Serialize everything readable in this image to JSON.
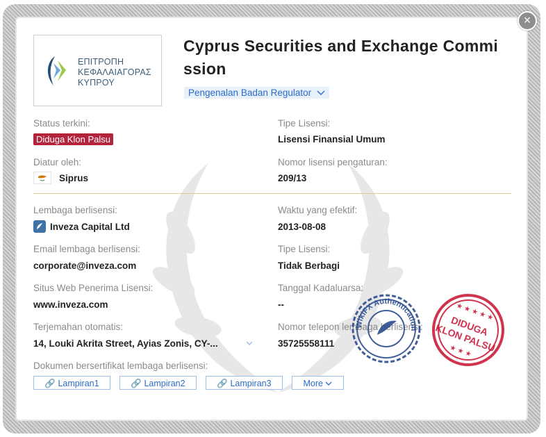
{
  "header": {
    "close_symbol": "×",
    "logo_lines": [
      "ΕΠΙΤΡΟΠΗ",
      "ΚΕΦΑΛΑΙΑΓΟΡΑΣ",
      "ΚΥΠΡΟΥ"
    ],
    "title": "Cyprus Securities and Exchange Commission",
    "title_line1": "Cyprus Securities and Exchange Commi",
    "title_line2": "ssion",
    "regulator_intro": "Pengenalan Badan Regulator"
  },
  "fields": {
    "status_label": "Status terkini:",
    "status_value": "Diduga Klon Palsu",
    "license_type_label": "Tipe Lisensi:",
    "license_type_value": "Lisensi Finansial Umum",
    "regulated_by_label": "Diatur oleh:",
    "regulated_by_value": "Siprus",
    "regulatory_license_no_label": "Nomor lisensi pengaturan:",
    "regulatory_license_no_value": "209/13",
    "licensed_institution_label": "Lembaga berlisensi:",
    "licensed_institution_value": "Inveza Capital Ltd",
    "effective_time_label": "Waktu yang efektif:",
    "effective_time_value": "2013-08-08",
    "institution_email_label": "Email lembaga berlisensi:",
    "institution_email_value": "corporate@inveza.com",
    "license_type2_label": "Tipe Lisensi:",
    "license_type2_value": "Tidak Berbagi",
    "website_label": "Situs Web Penerima Lisensi:",
    "website_value": "www.inveza.com",
    "expiry_label": "Tanggal Kadaluarsa:",
    "expiry_value": "--",
    "auto_translation_label": "Terjemahan otomatis:",
    "address_value": "14, Louki Akrita Street, Ayias Zonis, CY-...",
    "phone_label": "Nomor telepon lembaga berlisensi:",
    "phone_value": "35725558111",
    "documents_label": "Dokumen bersertifikat lembaga berlisensi:"
  },
  "attachments": [
    "Lampiran1",
    "Lampiran2",
    "Lampiran3"
  ],
  "more_label": "More",
  "stamps": {
    "auth_text": "WikiFX Authentication",
    "clone_line1": "DIDUGA",
    "clone_line2": "KLON PALSU"
  },
  "colors": {
    "accent_blue": "#2c6cc8",
    "status_red": "#b3243c",
    "stamp_red": "#c8102e",
    "stamp_blue": "#2b4e8f",
    "divider_gold": "#e3c896"
  }
}
